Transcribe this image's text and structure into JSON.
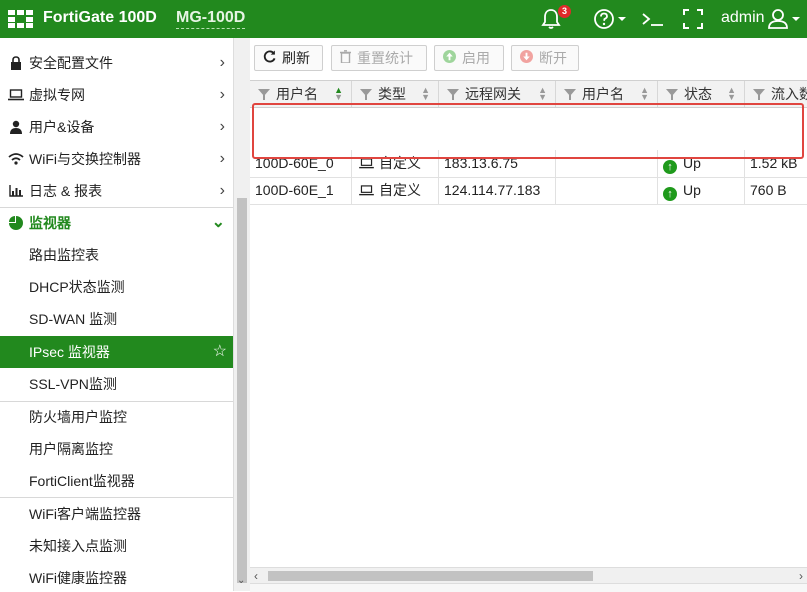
{
  "header": {
    "brand": "FortiGate 100D",
    "hostname": "MG-100D",
    "notification_count": "3",
    "user": "admin",
    "bg_color": "#22891e"
  },
  "sidebar": {
    "items": [
      {
        "label": "安全配置文件",
        "icon": "lock-icon",
        "arrow": "›"
      },
      {
        "label": "虚拟专网",
        "icon": "laptop-icon",
        "arrow": "›"
      },
      {
        "label": "用户&设备",
        "icon": "user-icon",
        "arrow": "›"
      },
      {
        "label": "WiFi与交换控制器",
        "icon": "wifi-icon",
        "arrow": "›"
      },
      {
        "label": "日志 & 报表",
        "icon": "chart-icon",
        "arrow": "›"
      },
      {
        "label": "监视器",
        "icon": "pie-icon",
        "arrow": "⌄"
      }
    ],
    "subitems": [
      {
        "label": "路由监控表"
      },
      {
        "label": "DHCP状态监测"
      },
      {
        "label": "SD-WAN 监测"
      },
      {
        "label": "IPsec 监视器"
      },
      {
        "label": "SSL-VPN监测"
      },
      {
        "label": "防火墙用户监控"
      },
      {
        "label": "用户隔离监控"
      },
      {
        "label": "FortiClient监视器"
      },
      {
        "label": "WiFi客户端监控器"
      },
      {
        "label": "未知接入点监测"
      },
      {
        "label": "WiFi健康监控器"
      }
    ]
  },
  "toolbar": {
    "refresh": "刷新",
    "reset_stats": "重置统计",
    "enable": "启用",
    "disconnect": "断开"
  },
  "table": {
    "columns": [
      "用户名",
      "类型",
      "远程网关",
      "用户名",
      "状态",
      "流入数据"
    ],
    "rows": [
      {
        "name": "100D-60E_0",
        "type": "自定义",
        "gateway": "183.13.6.75",
        "user": "",
        "status": "Up",
        "incoming": "1.52 kB"
      },
      {
        "name": "100D-60E_1",
        "type": "自定义",
        "gateway": "124.114.77.183",
        "user": "",
        "status": "Up",
        "incoming": "760 B"
      }
    ]
  },
  "colors": {
    "accent": "#22891e",
    "highlight_border": "#e0453f",
    "status_up": "#1f9a1c"
  }
}
